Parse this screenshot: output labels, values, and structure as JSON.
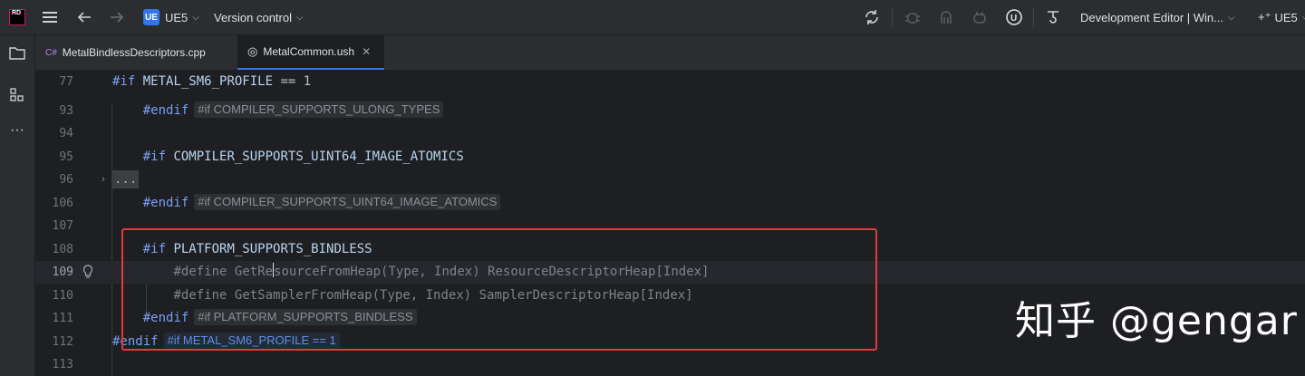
{
  "topbar": {
    "logo_text": "RD",
    "project": "UE5",
    "project_badge": "UE",
    "vcs_label": "Version control",
    "config_label": "Development Editor | Win...",
    "right_project": "UE5",
    "icons": [
      "menu-icon",
      "back-arrow-icon",
      "forward-arrow-icon",
      "sync-icon",
      "debug-icon",
      "run-icon",
      "profile-icon",
      "unreal-icon",
      "tools-icon",
      "add-config-icon"
    ]
  },
  "tabs": [
    {
      "label": "MetalBindlessDescriptors.cpp",
      "icon": "C#"
    },
    {
      "label": "MetalCommon.ush",
      "icon": "◎",
      "close": "✕"
    }
  ],
  "editor": {
    "lines": [
      {
        "num": "77",
        "text": "#if METAL_SM6_PROFILE == 1"
      },
      {
        "num": "93",
        "text": "    #endif",
        "hint": "#if COMPILER_SUPPORTS_ULONG_TYPES"
      },
      {
        "num": "94",
        "text": ""
      },
      {
        "num": "95",
        "text": "    #if COMPILER_SUPPORTS_UINT64_IMAGE_ATOMICS"
      },
      {
        "num": "96",
        "text": "..."
      },
      {
        "num": "106",
        "text": "    #endif",
        "hint": "#if COMPILER_SUPPORTS_UINT64_IMAGE_ATOMICS"
      },
      {
        "num": "107",
        "text": ""
      },
      {
        "num": "108",
        "text": "    #if PLATFORM_SUPPORTS_BINDLESS"
      },
      {
        "num": "109",
        "text": "        #define GetResourceFromHeap(Type, Index) ResourceDescriptorHeap[Index]"
      },
      {
        "num": "110",
        "text": "        #define GetSamplerFromHeap(Type, Index) SamplerDescriptorHeap[Index]"
      },
      {
        "num": "111",
        "text": "    #endif",
        "hint": "#if PLATFORM_SUPPORTS_BINDLESS"
      },
      {
        "num": "112",
        "text": "#endif",
        "hint": "#if METAL_SM6_PROFILE == 1"
      },
      {
        "num": "113",
        "text": ""
      }
    ],
    "define_kw": "#define",
    "res_macro": "GetRe",
    "res_macro_rest": "sourceFromHeap(Type, Index) ResourceDescriptorHeap[Index]",
    "samp_macro": "GetSamplerFromHeap(Type, Index) SamplerDescriptorHeap[Index]"
  },
  "watermark": "知乎 @gengar",
  "colors": {
    "highlight_box": "#e5383b",
    "accent": "#3574f0"
  }
}
